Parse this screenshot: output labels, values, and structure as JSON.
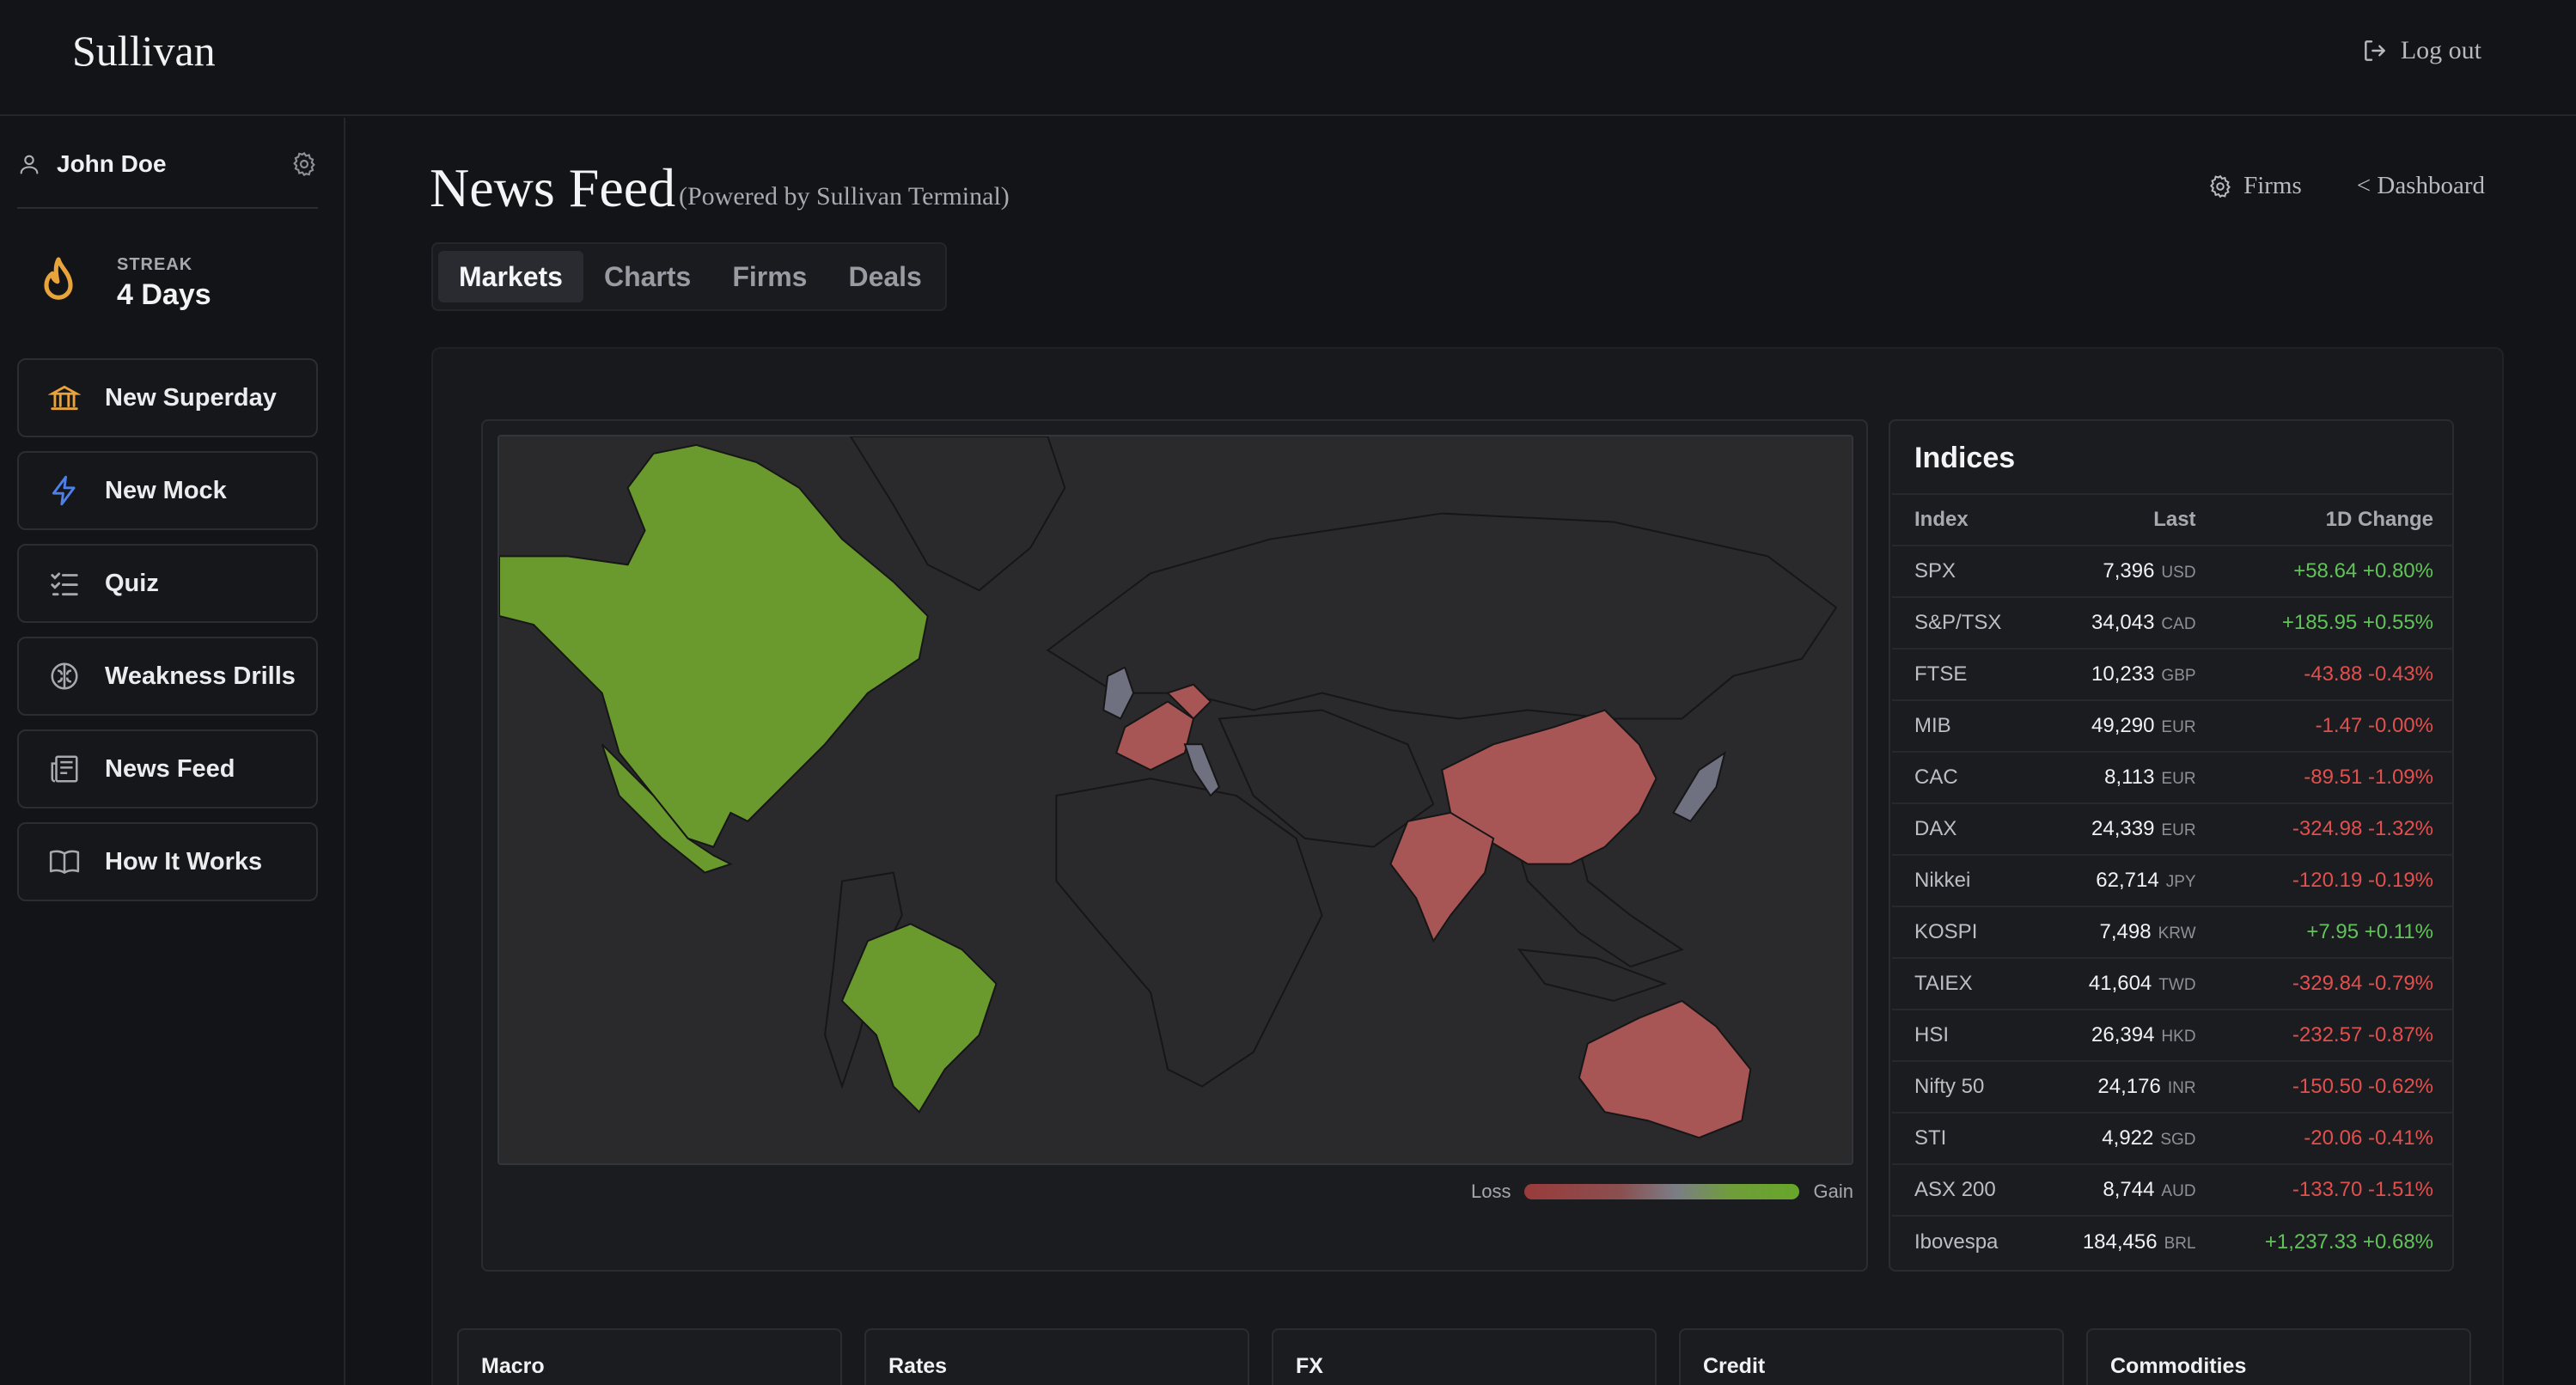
{
  "app": {
    "brand": "Sullivan",
    "logout_label": "Log out"
  },
  "user": {
    "name": "John Doe"
  },
  "streak": {
    "label": "STREAK",
    "value": "4 Days"
  },
  "nav": [
    {
      "label": "New Superday",
      "icon": "bank-icon"
    },
    {
      "label": "New Mock",
      "icon": "lightning-icon"
    },
    {
      "label": "Quiz",
      "icon": "checklist-icon"
    },
    {
      "label": "Weakness Drills",
      "icon": "brain-icon"
    },
    {
      "label": "News Feed",
      "icon": "newspaper-icon"
    },
    {
      "label": "How It Works",
      "icon": "book-icon"
    }
  ],
  "page": {
    "title": "News Feed",
    "subtitle": "(Powered by Sullivan Terminal)"
  },
  "header_links": {
    "firms": "Firms",
    "dashboard": "< Dashboard"
  },
  "tabs": [
    "Markets",
    "Charts",
    "Firms",
    "Deals"
  ],
  "active_tab": "Markets",
  "map": {
    "legend_loss": "Loss",
    "legend_gain": "Gain",
    "colors": {
      "gain": "#6a9a2e",
      "loss": "#a85555",
      "neutral": "#6f7080",
      "land": "#2a2a2c",
      "border": "#161617"
    }
  },
  "indices": {
    "title": "Indices",
    "headers": {
      "index": "Index",
      "last": "Last",
      "change": "1D Change"
    },
    "rows": [
      {
        "name": "SPX",
        "last": "7,396",
        "cur": "USD",
        "change": "+58.64 +0.80%",
        "dir": "pos"
      },
      {
        "name": "S&P/TSX",
        "last": "34,043",
        "cur": "CAD",
        "change": "+185.95 +0.55%",
        "dir": "pos"
      },
      {
        "name": "FTSE",
        "last": "10,233",
        "cur": "GBP",
        "change": "-43.88 -0.43%",
        "dir": "neg"
      },
      {
        "name": "MIB",
        "last": "49,290",
        "cur": "EUR",
        "change": "-1.47 -0.00%",
        "dir": "neg"
      },
      {
        "name": "CAC",
        "last": "8,113",
        "cur": "EUR",
        "change": "-89.51 -1.09%",
        "dir": "neg"
      },
      {
        "name": "DAX",
        "last": "24,339",
        "cur": "EUR",
        "change": "-324.98 -1.32%",
        "dir": "neg"
      },
      {
        "name": "Nikkei",
        "last": "62,714",
        "cur": "JPY",
        "change": "-120.19 -0.19%",
        "dir": "neg"
      },
      {
        "name": "KOSPI",
        "last": "7,498",
        "cur": "KRW",
        "change": "+7.95 +0.11%",
        "dir": "pos"
      },
      {
        "name": "TAIEX",
        "last": "41,604",
        "cur": "TWD",
        "change": "-329.84 -0.79%",
        "dir": "neg"
      },
      {
        "name": "HSI",
        "last": "26,394",
        "cur": "HKD",
        "change": "-232.57 -0.87%",
        "dir": "neg"
      },
      {
        "name": "Nifty 50",
        "last": "24,176",
        "cur": "INR",
        "change": "-150.50 -0.62%",
        "dir": "neg"
      },
      {
        "name": "STI",
        "last": "4,922",
        "cur": "SGD",
        "change": "-20.06 -0.41%",
        "dir": "neg"
      },
      {
        "name": "ASX 200",
        "last": "8,744",
        "cur": "AUD",
        "change": "-133.70 -1.51%",
        "dir": "neg"
      },
      {
        "name": "Ibovespa",
        "last": "184,456",
        "cur": "BRL",
        "change": "+1,237.33 +0.68%",
        "dir": "pos"
      }
    ]
  },
  "cards": [
    "Macro",
    "Rates",
    "FX",
    "Credit",
    "Commodities"
  ]
}
